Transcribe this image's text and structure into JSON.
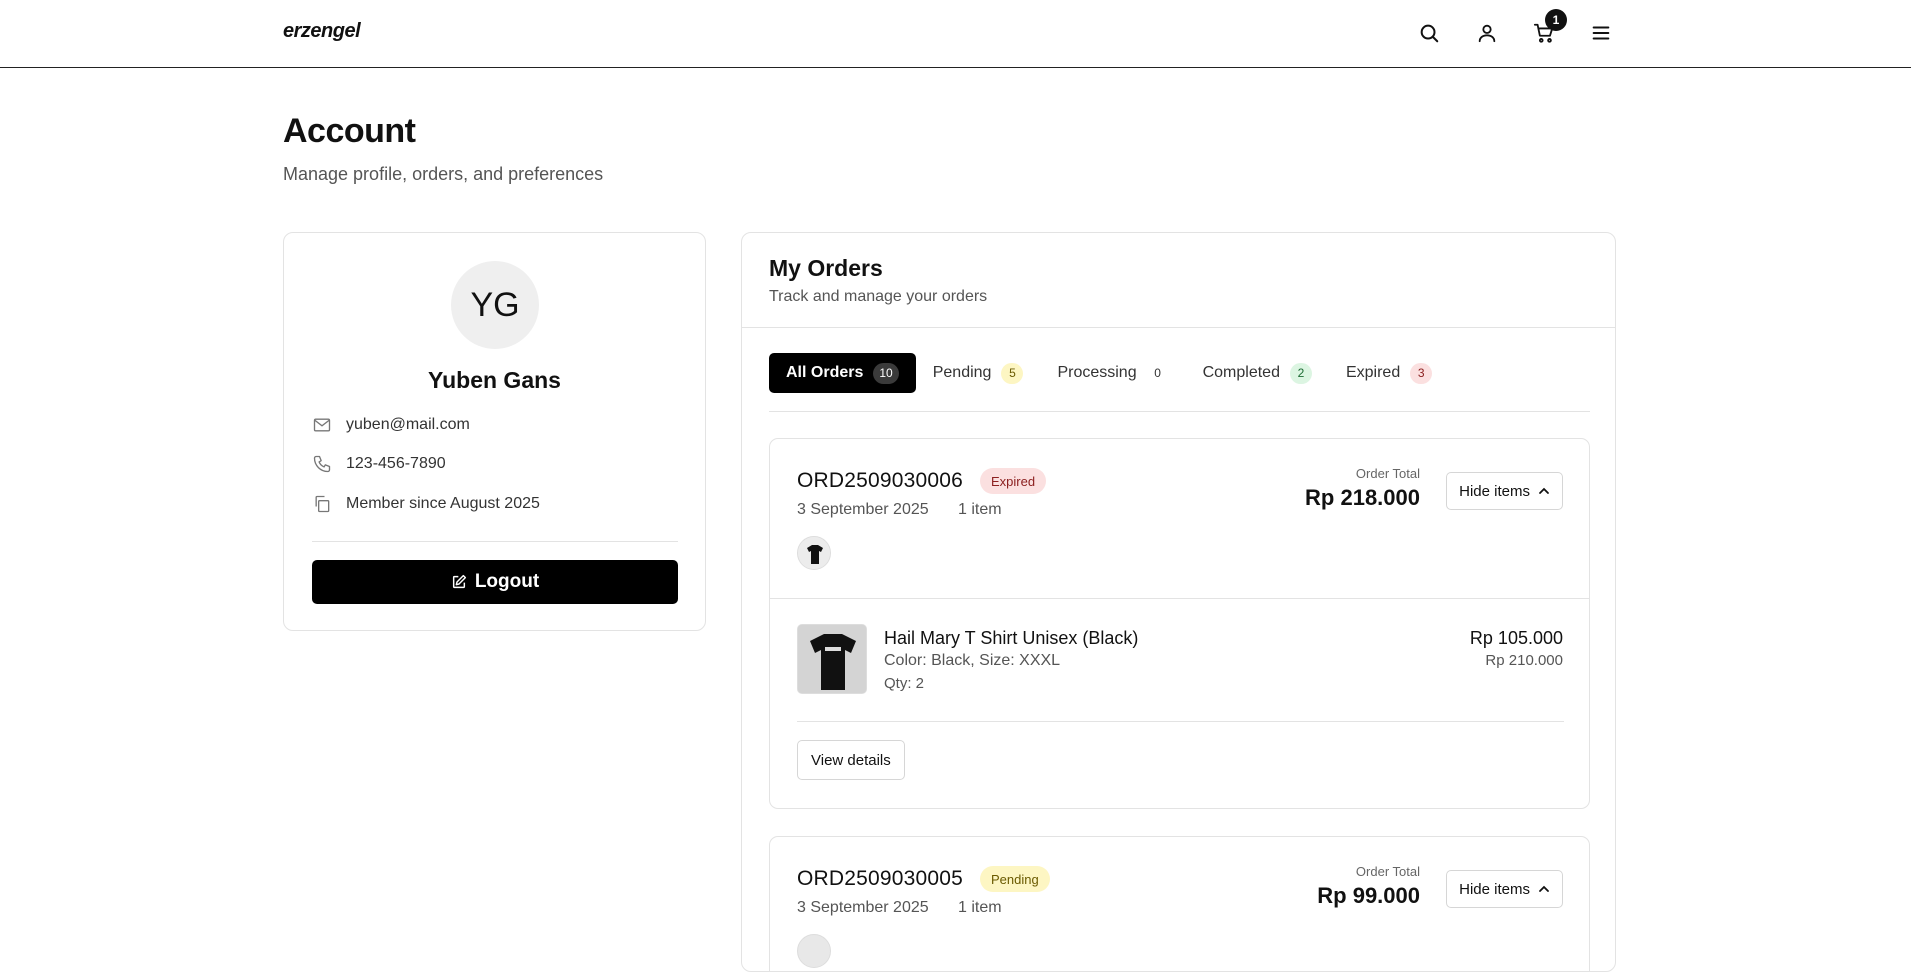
{
  "header": {
    "brand": "erzengel",
    "cart_count": "1",
    "icons": [
      "search-icon",
      "user-icon",
      "cart-icon",
      "menu-icon"
    ]
  },
  "page": {
    "title": "Account",
    "subtitle": "Manage profile, orders, and preferences"
  },
  "profile": {
    "initials": "YG",
    "name": "Yuben Gans",
    "email": "yuben@mail.com",
    "phone": "123-456-7890",
    "member_since": "Member since August 2025",
    "logout_label": "Logout"
  },
  "orders": {
    "title": "My Orders",
    "subtitle": "Track and manage your orders",
    "tabs": [
      {
        "label": "All Orders",
        "count": "10",
        "active": true
      },
      {
        "label": "Pending",
        "count": "5",
        "color": "yellow"
      },
      {
        "label": "Processing",
        "count": "0",
        "color": "gray"
      },
      {
        "label": "Completed",
        "count": "2",
        "color": "green"
      },
      {
        "label": "Expired",
        "count": "3",
        "color": "red"
      }
    ],
    "list": [
      {
        "id": "ORD2509030006",
        "status": "Expired",
        "date": "3 September 2025",
        "item_count": "1 item",
        "total_label": "Order Total",
        "total": "Rp 218.000",
        "toggle_label": "Hide items",
        "items": [
          {
            "name": "Hail Mary T Shirt Unisex (Black)",
            "variant": "Color: Black, Size: XXXL",
            "qty": "Qty: 2",
            "price": "Rp 105.000",
            "subtotal": "Rp 210.000"
          }
        ],
        "details_label": "View details"
      },
      {
        "id": "ORD2509030005",
        "status": "Pending",
        "date": "3 September 2025",
        "item_count": "1 item",
        "total_label": "Order Total",
        "total": "Rp 99.000",
        "toggle_label": "Hide items"
      }
    ]
  }
}
